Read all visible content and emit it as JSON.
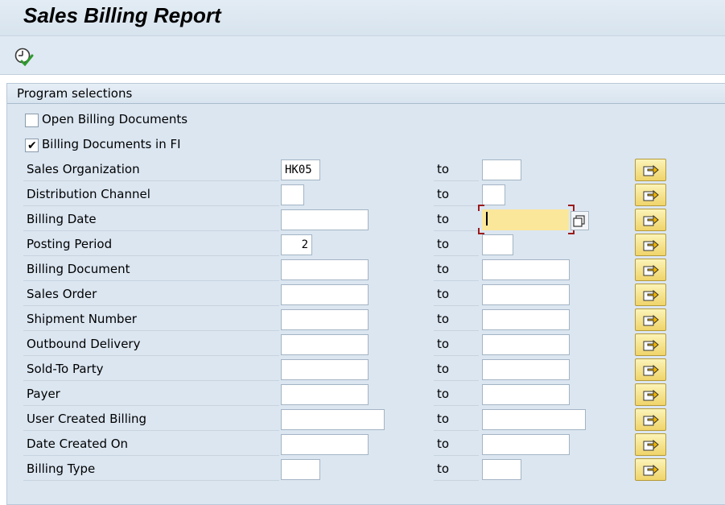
{
  "title": "Sales Billing Report",
  "toolbar": {
    "execute_icon": "execute-clock-check-icon"
  },
  "group": {
    "title": "Program selections"
  },
  "checkboxes": [
    {
      "label": "Open Billing Documents",
      "checked": false
    },
    {
      "label": "Billing Documents in FI",
      "checked": true
    }
  ],
  "check_mark": "✔",
  "to_label": "to",
  "rows": [
    {
      "label": "Sales Organization",
      "from": "HK05",
      "to": ""
    },
    {
      "label": "Distribution Channel",
      "from": "",
      "to": ""
    },
    {
      "label": "Billing Date",
      "from": "",
      "to": ""
    },
    {
      "label": "Posting Period",
      "from": "2",
      "to": ""
    },
    {
      "label": "Billing Document",
      "from": "",
      "to": ""
    },
    {
      "label": "Sales Order",
      "from": "",
      "to": ""
    },
    {
      "label": "Shipment Number",
      "from": "",
      "to": ""
    },
    {
      "label": "Outbound Delivery",
      "from": "",
      "to": ""
    },
    {
      "label": "Sold-To Party",
      "from": "",
      "to": ""
    },
    {
      "label": "Payer",
      "from": "",
      "to": ""
    },
    {
      "label": "User Created Billing",
      "from": "",
      "to": ""
    },
    {
      "label": "Date Created On",
      "from": "",
      "to": ""
    },
    {
      "label": "Billing Type",
      "from": "",
      "to": ""
    }
  ],
  "colors": {
    "header_bg": "#dbe6f1",
    "focus_bg": "#fbe79a",
    "focus_frame": "#9b1b1b",
    "button_bg": "#f0d46a"
  },
  "icons": {
    "multiple_selection": "multiple-selection-arrow-icon",
    "value_help": "value-help-icon"
  }
}
